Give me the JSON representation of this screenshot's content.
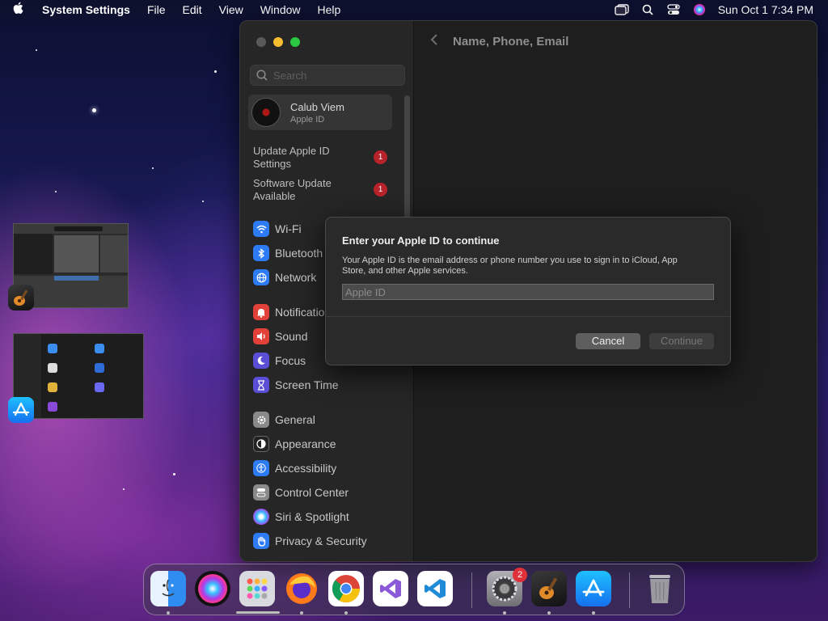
{
  "menubar": {
    "app_name": "System Settings",
    "menus": [
      "File",
      "Edit",
      "View",
      "Window",
      "Help"
    ],
    "clock": "Sun Oct 1  7:34 PM"
  },
  "sidebar": {
    "search_placeholder": "Search",
    "account": {
      "name": "Calub Viem",
      "subtitle": "Apple ID"
    },
    "notices": [
      {
        "label": "Update Apple ID Settings",
        "badge": "1"
      },
      {
        "label": "Software Update Available",
        "badge": "1"
      }
    ],
    "items": [
      {
        "label": "Wi-Fi",
        "icon": "wifi-icon",
        "color": "#2d7cf6"
      },
      {
        "label": "Bluetooth",
        "icon": "bluetooth-icon",
        "color": "#2d7cf6"
      },
      {
        "label": "Network",
        "icon": "globe-icon",
        "color": "#2d7cf6"
      },
      {
        "label": "Notifications",
        "icon": "bell-icon",
        "color": "#e2413a"
      },
      {
        "label": "Sound",
        "icon": "speaker-icon",
        "color": "#e2413a"
      },
      {
        "label": "Focus",
        "icon": "moon-icon",
        "color": "#5b4ed6"
      },
      {
        "label": "Screen Time",
        "icon": "hourglass-icon",
        "color": "#5b4ed6"
      },
      {
        "label": "General",
        "icon": "gear-icon",
        "color": "#8a8a8a"
      },
      {
        "label": "Appearance",
        "icon": "appearance-icon",
        "color": "#222222"
      },
      {
        "label": "Accessibility",
        "icon": "accessibility-icon",
        "color": "#2d7cf6"
      },
      {
        "label": "Control Center",
        "icon": "control-center-icon",
        "color": "#8a8a8a"
      },
      {
        "label": "Siri & Spotlight",
        "icon": "siri-icon",
        "color": "#b43ad9"
      },
      {
        "label": "Privacy & Security",
        "icon": "hand-icon",
        "color": "#2d7cf6"
      }
    ]
  },
  "content": {
    "title": "Name, Phone, Email"
  },
  "dialog": {
    "title": "Enter your Apple ID to continue",
    "description": "Your Apple ID is the email address or phone number you use to sign in to iCloud, App Store, and other Apple services.",
    "input_placeholder": "Apple ID",
    "input_value": "",
    "cancel_label": "Cancel",
    "continue_label": "Continue"
  },
  "dock": {
    "apps": [
      {
        "name": "finder-icon",
        "color": "#2f8cf0"
      },
      {
        "name": "siri-icon",
        "color": "#6a2cd0"
      },
      {
        "name": "launchpad-icon",
        "color": "#cfcfd6"
      },
      {
        "name": "firefox-icon",
        "color": "#ff7a1a"
      },
      {
        "name": "chrome-icon",
        "color": "#ffffff"
      },
      {
        "name": "visual-studio-icon",
        "color": "#ffffff"
      },
      {
        "name": "vscode-icon",
        "color": "#ffffff"
      },
      {
        "name": "system-settings-icon",
        "color": "#8e8e93",
        "badge": "2"
      },
      {
        "name": "garageband-icon",
        "color": "#2a2a2a"
      },
      {
        "name": "app-store-icon",
        "color": "#1c8cf5"
      },
      {
        "name": "trash-icon",
        "color": "#9a9aa0"
      }
    ]
  }
}
